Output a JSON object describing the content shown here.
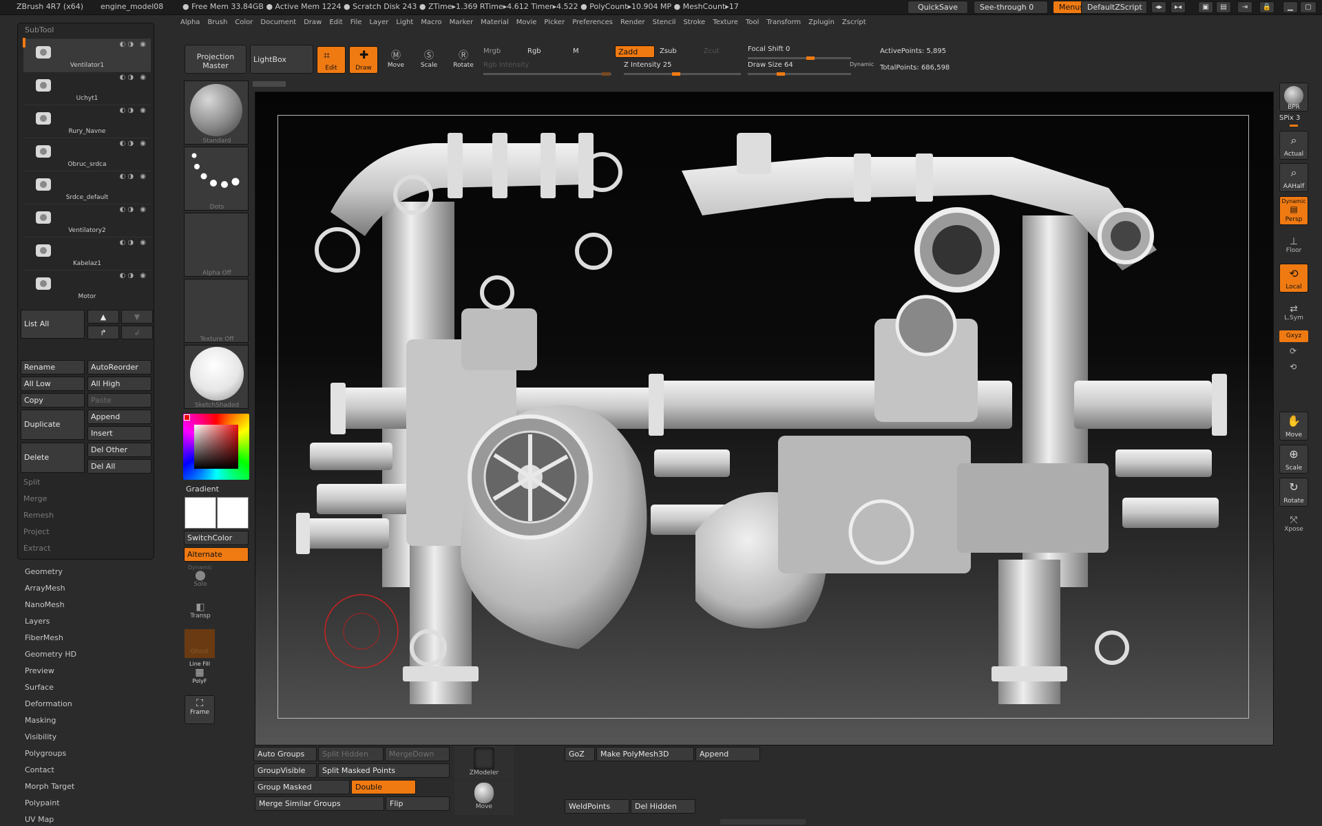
{
  "titlebar": {
    "app": "ZBrush 4R7 (x64)",
    "doc": "engine_model08",
    "stats": "● Free Mem 33.84GB ● Active Mem 1224 ● Scratch Disk 243 ● ZTime▸1.369 RTime▸4.612 Timer▸4.522 ● PolyCount▸10.904 MP ● MeshCount▸17",
    "quicksave": "QuickSave",
    "seethrough": "See-through  0",
    "menus": "Menus",
    "script": "DefaultZScript"
  },
  "menubar": [
    "Alpha",
    "Brush",
    "Color",
    "Document",
    "Draw",
    "Edit",
    "File",
    "Layer",
    "Light",
    "Macro",
    "Marker",
    "Material",
    "Movie",
    "Picker",
    "Preferences",
    "Render",
    "Stencil",
    "Stroke",
    "Texture",
    "Tool",
    "Transform",
    "Zplugin",
    "Zscript"
  ],
  "subtool": {
    "title": "SubTool",
    "items": [
      "Ventilator1",
      "Uchyt1",
      "Rury_Navne",
      "Obruc_srdca",
      "Srdce_default",
      "Ventilatory2",
      "Kabelaz1",
      "Motor"
    ],
    "list_all": "List All",
    "rename": "Rename",
    "autoreorder": "AutoReorder",
    "all_low": "All Low",
    "all_high": "All High",
    "copy": "Copy",
    "paste": "Paste",
    "duplicate": "Duplicate",
    "append": "Append",
    "insert": "Insert",
    "delete": "Delete",
    "del_other": "Del Other",
    "del_all": "Del All",
    "split": "Split",
    "merge": "Merge",
    "remesh": "Remesh",
    "project": "Project",
    "extract": "Extract"
  },
  "left_menu": [
    "Geometry",
    "ArrayMesh",
    "NanoMesh",
    "Layers",
    "FiberMesh",
    "Geometry HD",
    "Preview",
    "Surface",
    "Deformation",
    "Masking",
    "Visibility",
    "Polygroups",
    "Contact",
    "Morph Target",
    "Polypaint",
    "UV Map"
  ],
  "shelf": {
    "projection_master": "Projection Master",
    "lightbox": "LightBox",
    "edit": "Edit",
    "draw": "Draw",
    "move": "Move",
    "scale": "Scale",
    "rotate": "Rotate",
    "mrgb": "Mrgb",
    "rgb": "Rgb",
    "m": "M",
    "zadd": "Zadd",
    "zsub": "Zsub",
    "zcut": "Zcut",
    "rgb_intensity": "Rgb Intensity",
    "z_intensity": "Z Intensity 25",
    "focal_shift": "Focal Shift 0",
    "draw_size": "Draw Size 64",
    "dynamic": "Dynamic",
    "active_points": "ActivePoints: 5,895",
    "total_points": "TotalPoints: 686,598"
  },
  "brush_column": {
    "standard": "Standard",
    "dots": "Dots",
    "alpha": "Alpha  Off",
    "texture": "Texture  Off",
    "material": "SketchShaded",
    "gradient": "Gradient",
    "switchcolor": "SwitchColor",
    "alternate": "Alternate",
    "dynamic": "Dynamic",
    "solo": "Solo",
    "transp": "Transp",
    "ghost": "Ghost",
    "line_fill": "Line Fill",
    "polyf": "PolyF",
    "frame": "Frame"
  },
  "right_column": {
    "bpr": "BPR",
    "spix": "SPix 3",
    "actual": "Actual",
    "aahalf": "AAHalf",
    "dynamic": "Dynamic",
    "persp": "Persp",
    "floor": "Floor",
    "local": "Local",
    "lsym": "L.Sym",
    "xyz": "Gxyz",
    "move": "Move",
    "scale": "Scale",
    "rotate": "Rotate",
    "xpose": "Xpose"
  },
  "bottom": {
    "auto_groups": "Auto Groups",
    "split_hidden": "Split Hidden",
    "mergedown": "MergeDown",
    "groupvisible": "GroupVisible",
    "split_masked": "Split Masked Points",
    "group_masked": "Group Masked",
    "double": "Double",
    "merge_similar": "Merge Similar Groups",
    "flip": "Flip",
    "zmodeler": "ZModeler",
    "move": "Move",
    "goz": "GoZ",
    "make_polymesh": "Make PolyMesh3D",
    "append": "Append",
    "weldpoints": "WeldPoints",
    "del_hidden": "Del Hidden"
  },
  "colors": {
    "accent": "#f07a12",
    "panel": "#262626",
    "button": "#3a3a3a"
  }
}
